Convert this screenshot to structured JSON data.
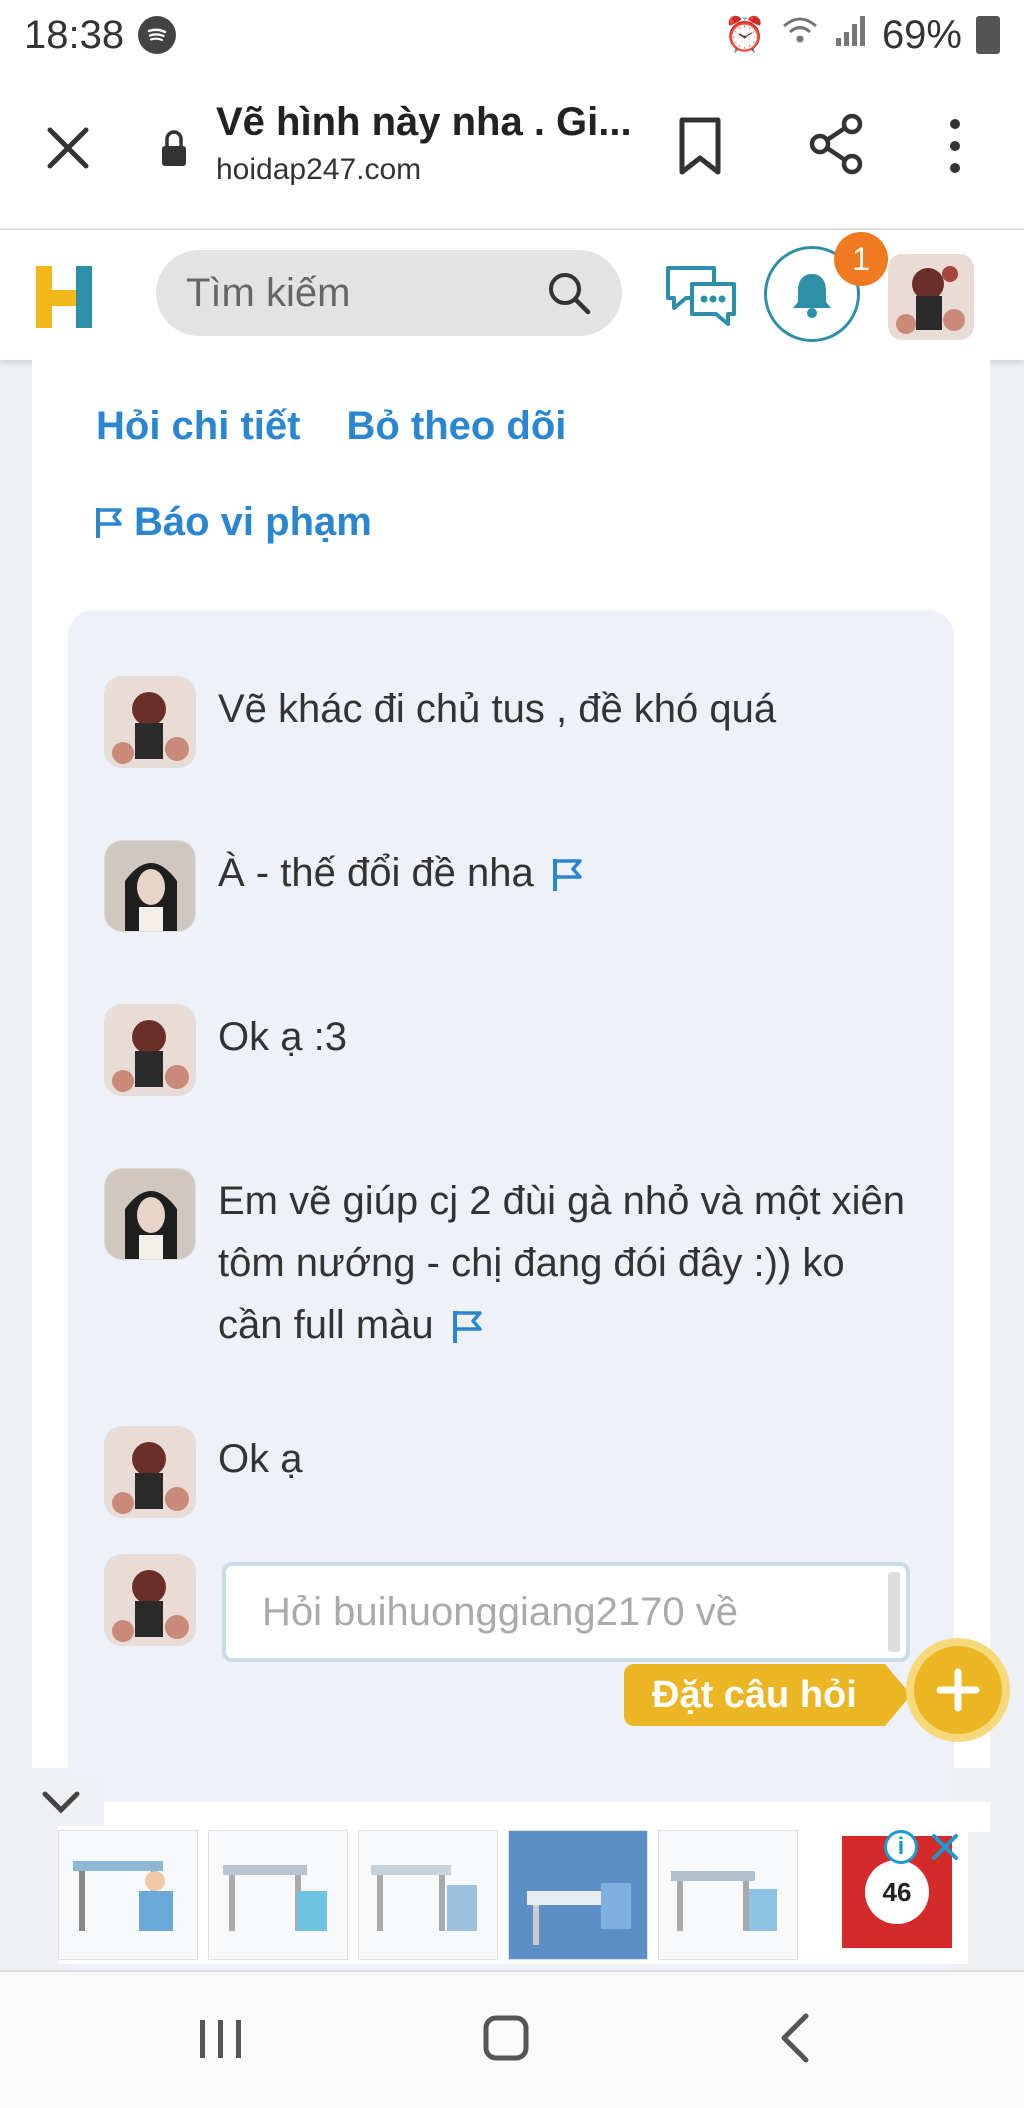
{
  "status_bar": {
    "time": "18:38",
    "battery": "69%"
  },
  "browser": {
    "page_title": "Vẽ hình này nha . Gi...",
    "domain": "hoidap247.com"
  },
  "header": {
    "search_placeholder": "Tìm kiếm",
    "notification_count": "1"
  },
  "question_actions": {
    "ask_detail": "Hỏi chi tiết",
    "unfollow": "Bỏ theo dõi",
    "report": "Báo vi phạm"
  },
  "comments": [
    {
      "text": "Vẽ khác đi chủ tus , đề khó quá"
    },
    {
      "text": "À - thế đổi đề nha"
    },
    {
      "text": "Ok ạ :3"
    },
    {
      "text": "Em vẽ giúp cj 2 đùi gà nhỏ và một xiên tôm nướng - chị đang đói đây :)) ko cần full màu"
    },
    {
      "text": "Ok ạ"
    }
  ],
  "reply_placeholder": "Hỏi buihuonggiang2170 về",
  "ask_button_label": "Đặt câu hỏi",
  "ad": {
    "badge": "46"
  },
  "colors": {
    "link": "#2b86d1",
    "accent": "#ebb524",
    "badge": "#f07a21",
    "teal": "#2e8fa8"
  }
}
